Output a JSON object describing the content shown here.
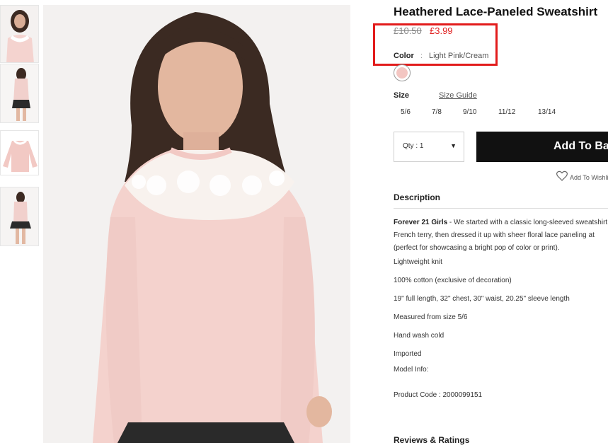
{
  "product": {
    "title": "Heathered Lace-Paneled Sweatshirt",
    "price_old": "£10.50",
    "price_new": "£3.99",
    "color_label": "Color",
    "color_separator": ":",
    "color_value": "Light Pink/Cream",
    "swatch_color": "#f3c6c2",
    "size_label": "Size",
    "size_guide_label": "Size Guide",
    "sizes": [
      "5/6",
      "7/8",
      "9/10",
      "11/12",
      "13/14"
    ],
    "qty_label": "Qty : 1",
    "add_button": "Add To Bag",
    "wishlist_label": "Add To Wishlist",
    "accent_color": "#e02020",
    "highlight_color": "#e21b1b"
  },
  "description": {
    "heading": "Description",
    "brand": "Forever 21 Girls",
    "line1": " - We started with a classic long-sleeved sweatshirt",
    "line2": "French terry, then dressed it up with sheer floral lace paneling at",
    "line3": "(perfect for showcasing a bright pop of color or print).",
    "details": [
      "Lightweight knit",
      "100% cotton (exclusive of decoration)",
      "19\" full length, 32\" chest, 30\" waist, 20.25\" sleeve length",
      "Measured from size 5/6",
      "Hand wash cold",
      "Imported",
      "Model Info:"
    ],
    "product_code": "Product Code : 2000099151"
  },
  "reviews": {
    "heading": "Reviews & Ratings"
  },
  "icons": {
    "wishlist": "heart-outline-icon",
    "qty_dropdown": "caret-down-icon"
  }
}
